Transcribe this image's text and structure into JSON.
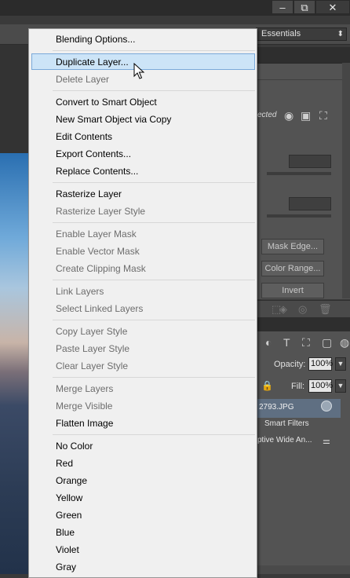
{
  "app": {
    "workspace": "Essentials",
    "window_buttons": [
      "–",
      "⧉",
      "✕"
    ]
  },
  "properties_panel": {
    "selected_label": "ected",
    "buttons": [
      "Mask Edge...",
      "Color Range...",
      "Invert"
    ]
  },
  "layers_panel": {
    "opacity_label": "Opacity:",
    "opacity_value": "100%",
    "fill_label": "Fill:",
    "fill_value": "100%",
    "layer_name": "2793.JPG",
    "smart_filters_label": "Smart Filters",
    "filter_name": "ptive Wide An..."
  },
  "context_menu": {
    "items": [
      {
        "label": "Blending Options...",
        "enabled": true
      },
      {
        "label": "Duplicate Layer...",
        "enabled": true,
        "highlighted": true
      },
      {
        "label": "Delete Layer",
        "enabled": false
      },
      {
        "label": "Convert to Smart Object",
        "enabled": true
      },
      {
        "label": "New Smart Object via Copy",
        "enabled": true
      },
      {
        "label": "Edit Contents",
        "enabled": true
      },
      {
        "label": "Export Contents...",
        "enabled": true
      },
      {
        "label": "Replace Contents...",
        "enabled": true
      },
      {
        "label": "Rasterize Layer",
        "enabled": true
      },
      {
        "label": "Rasterize Layer Style",
        "enabled": false
      },
      {
        "label": "Enable Layer Mask",
        "enabled": false
      },
      {
        "label": "Enable Vector Mask",
        "enabled": false
      },
      {
        "label": "Create Clipping Mask",
        "enabled": false
      },
      {
        "label": "Link Layers",
        "enabled": false
      },
      {
        "label": "Select Linked Layers",
        "enabled": false
      },
      {
        "label": "Copy Layer Style",
        "enabled": false
      },
      {
        "label": "Paste Layer Style",
        "enabled": false
      },
      {
        "label": "Clear Layer Style",
        "enabled": false
      },
      {
        "label": "Merge Layers",
        "enabled": false
      },
      {
        "label": "Merge Visible",
        "enabled": false
      },
      {
        "label": "Flatten Image",
        "enabled": true
      },
      {
        "label": "No Color",
        "enabled": true
      },
      {
        "label": "Red",
        "enabled": true
      },
      {
        "label": "Orange",
        "enabled": true
      },
      {
        "label": "Yellow",
        "enabled": true
      },
      {
        "label": "Green",
        "enabled": true
      },
      {
        "label": "Blue",
        "enabled": true
      },
      {
        "label": "Violet",
        "enabled": true
      },
      {
        "label": "Gray",
        "enabled": true
      }
    ]
  }
}
